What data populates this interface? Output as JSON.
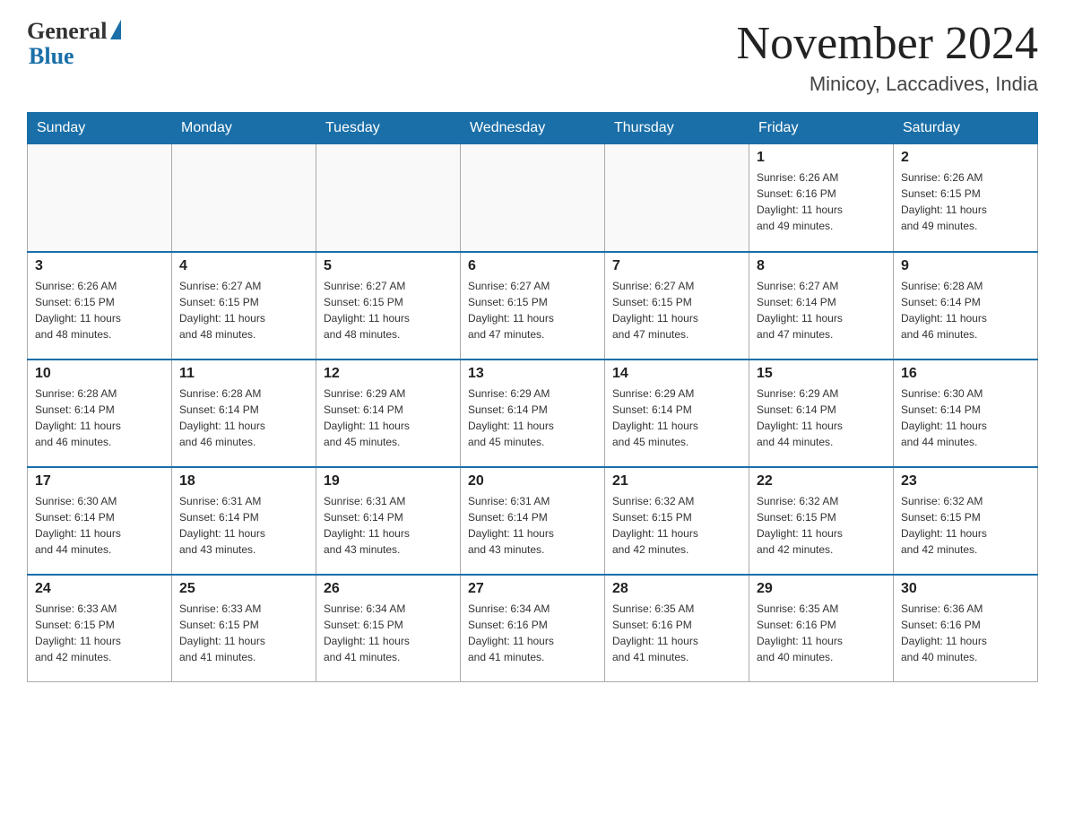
{
  "logo": {
    "general": "General",
    "blue": "Blue"
  },
  "header": {
    "title": "November 2024",
    "location": "Minicoy, Laccadives, India"
  },
  "weekdays": [
    "Sunday",
    "Monday",
    "Tuesday",
    "Wednesday",
    "Thursday",
    "Friday",
    "Saturday"
  ],
  "weeks": [
    [
      {
        "day": "",
        "info": ""
      },
      {
        "day": "",
        "info": ""
      },
      {
        "day": "",
        "info": ""
      },
      {
        "day": "",
        "info": ""
      },
      {
        "day": "",
        "info": ""
      },
      {
        "day": "1",
        "info": "Sunrise: 6:26 AM\nSunset: 6:16 PM\nDaylight: 11 hours\nand 49 minutes."
      },
      {
        "day": "2",
        "info": "Sunrise: 6:26 AM\nSunset: 6:15 PM\nDaylight: 11 hours\nand 49 minutes."
      }
    ],
    [
      {
        "day": "3",
        "info": "Sunrise: 6:26 AM\nSunset: 6:15 PM\nDaylight: 11 hours\nand 48 minutes."
      },
      {
        "day": "4",
        "info": "Sunrise: 6:27 AM\nSunset: 6:15 PM\nDaylight: 11 hours\nand 48 minutes."
      },
      {
        "day": "5",
        "info": "Sunrise: 6:27 AM\nSunset: 6:15 PM\nDaylight: 11 hours\nand 48 minutes."
      },
      {
        "day": "6",
        "info": "Sunrise: 6:27 AM\nSunset: 6:15 PM\nDaylight: 11 hours\nand 47 minutes."
      },
      {
        "day": "7",
        "info": "Sunrise: 6:27 AM\nSunset: 6:15 PM\nDaylight: 11 hours\nand 47 minutes."
      },
      {
        "day": "8",
        "info": "Sunrise: 6:27 AM\nSunset: 6:14 PM\nDaylight: 11 hours\nand 47 minutes."
      },
      {
        "day": "9",
        "info": "Sunrise: 6:28 AM\nSunset: 6:14 PM\nDaylight: 11 hours\nand 46 minutes."
      }
    ],
    [
      {
        "day": "10",
        "info": "Sunrise: 6:28 AM\nSunset: 6:14 PM\nDaylight: 11 hours\nand 46 minutes."
      },
      {
        "day": "11",
        "info": "Sunrise: 6:28 AM\nSunset: 6:14 PM\nDaylight: 11 hours\nand 46 minutes."
      },
      {
        "day": "12",
        "info": "Sunrise: 6:29 AM\nSunset: 6:14 PM\nDaylight: 11 hours\nand 45 minutes."
      },
      {
        "day": "13",
        "info": "Sunrise: 6:29 AM\nSunset: 6:14 PM\nDaylight: 11 hours\nand 45 minutes."
      },
      {
        "day": "14",
        "info": "Sunrise: 6:29 AM\nSunset: 6:14 PM\nDaylight: 11 hours\nand 45 minutes."
      },
      {
        "day": "15",
        "info": "Sunrise: 6:29 AM\nSunset: 6:14 PM\nDaylight: 11 hours\nand 44 minutes."
      },
      {
        "day": "16",
        "info": "Sunrise: 6:30 AM\nSunset: 6:14 PM\nDaylight: 11 hours\nand 44 minutes."
      }
    ],
    [
      {
        "day": "17",
        "info": "Sunrise: 6:30 AM\nSunset: 6:14 PM\nDaylight: 11 hours\nand 44 minutes."
      },
      {
        "day": "18",
        "info": "Sunrise: 6:31 AM\nSunset: 6:14 PM\nDaylight: 11 hours\nand 43 minutes."
      },
      {
        "day": "19",
        "info": "Sunrise: 6:31 AM\nSunset: 6:14 PM\nDaylight: 11 hours\nand 43 minutes."
      },
      {
        "day": "20",
        "info": "Sunrise: 6:31 AM\nSunset: 6:14 PM\nDaylight: 11 hours\nand 43 minutes."
      },
      {
        "day": "21",
        "info": "Sunrise: 6:32 AM\nSunset: 6:15 PM\nDaylight: 11 hours\nand 42 minutes."
      },
      {
        "day": "22",
        "info": "Sunrise: 6:32 AM\nSunset: 6:15 PM\nDaylight: 11 hours\nand 42 minutes."
      },
      {
        "day": "23",
        "info": "Sunrise: 6:32 AM\nSunset: 6:15 PM\nDaylight: 11 hours\nand 42 minutes."
      }
    ],
    [
      {
        "day": "24",
        "info": "Sunrise: 6:33 AM\nSunset: 6:15 PM\nDaylight: 11 hours\nand 42 minutes."
      },
      {
        "day": "25",
        "info": "Sunrise: 6:33 AM\nSunset: 6:15 PM\nDaylight: 11 hours\nand 41 minutes."
      },
      {
        "day": "26",
        "info": "Sunrise: 6:34 AM\nSunset: 6:15 PM\nDaylight: 11 hours\nand 41 minutes."
      },
      {
        "day": "27",
        "info": "Sunrise: 6:34 AM\nSunset: 6:16 PM\nDaylight: 11 hours\nand 41 minutes."
      },
      {
        "day": "28",
        "info": "Sunrise: 6:35 AM\nSunset: 6:16 PM\nDaylight: 11 hours\nand 41 minutes."
      },
      {
        "day": "29",
        "info": "Sunrise: 6:35 AM\nSunset: 6:16 PM\nDaylight: 11 hours\nand 40 minutes."
      },
      {
        "day": "30",
        "info": "Sunrise: 6:36 AM\nSunset: 6:16 PM\nDaylight: 11 hours\nand 40 minutes."
      }
    ]
  ]
}
